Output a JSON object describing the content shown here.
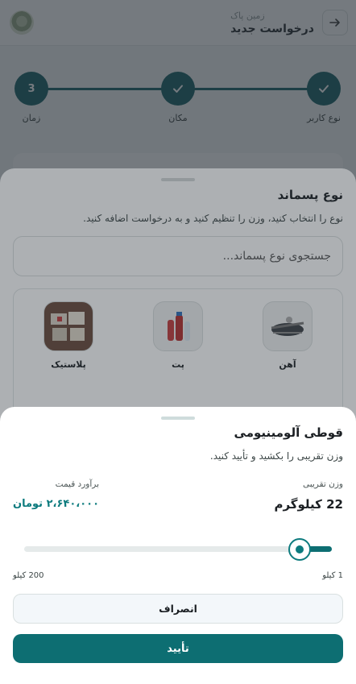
{
  "header": {
    "subtitle": "زمین پاک",
    "title": "درخواست جدید"
  },
  "stepper": {
    "steps": [
      {
        "label": "نوع کاربر",
        "state": "done"
      },
      {
        "label": "مکان",
        "state": "done"
      },
      {
        "label": "زمان",
        "state": "current",
        "number": "3"
      }
    ]
  },
  "waste_sheet": {
    "title": "نوع پسماند",
    "description": "نوع را انتخاب کنید، وزن را تنظیم کنید و به درخواست اضافه کنید.",
    "search_placeholder": "جستجوی نوع پسماند...",
    "categories": [
      {
        "label": "آهن",
        "icon": "iron-image"
      },
      {
        "label": "پت",
        "icon": "pet-bottles-image"
      },
      {
        "label": "پلاستیک",
        "icon": "plastic-image"
      }
    ]
  },
  "weight_sheet": {
    "title": "قوطی آلومینیومی",
    "description": "وزن تقریبی را بکشید و تأیید کنید.",
    "weight_label": "وزن تقریبی",
    "weight_value": "22 کیلوگرم",
    "price_label": "برآورد قیمت",
    "price_value": "۲،۶۴۰،۰۰۰ تومان",
    "slider": {
      "min": 1,
      "max": 200,
      "value": 22,
      "min_label": "1 کیلو",
      "max_label": "200 کیلو"
    },
    "cancel_label": "انصراف",
    "confirm_label": "تأیید"
  },
  "colors": {
    "primary": "#0d6e72",
    "accent_price": "#0d7b7e"
  }
}
